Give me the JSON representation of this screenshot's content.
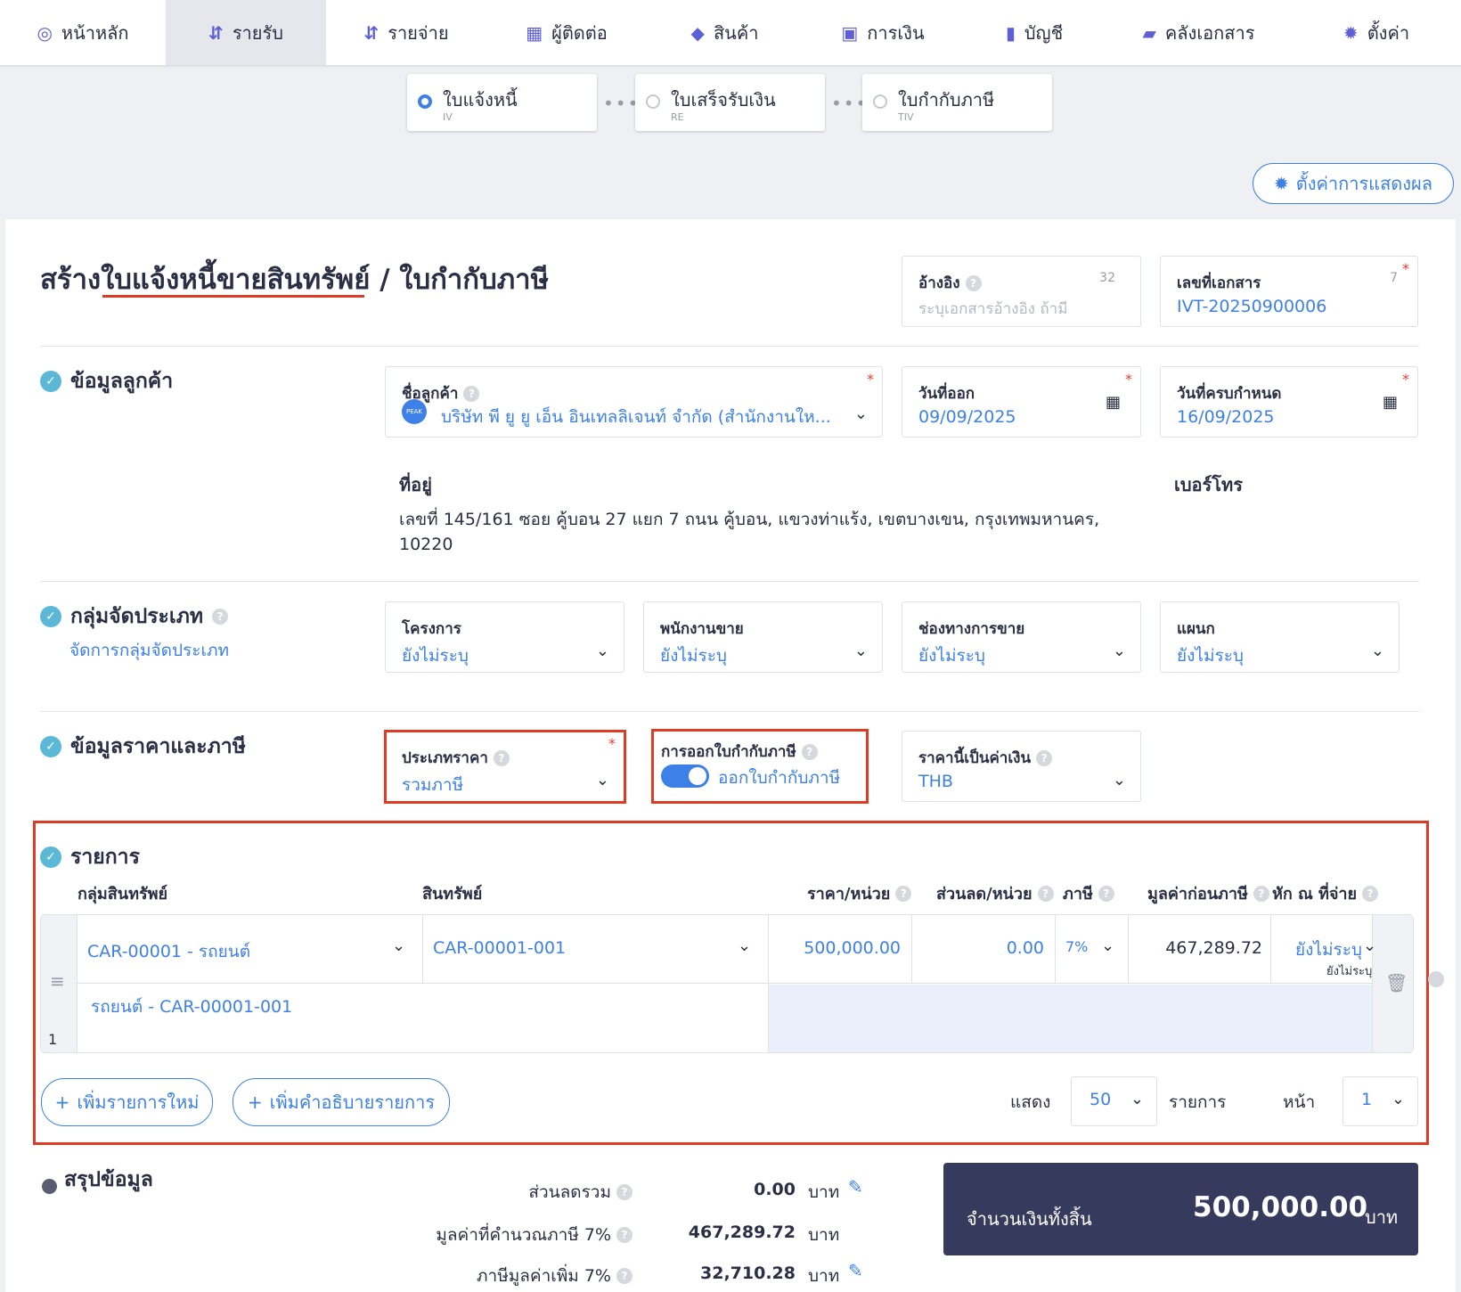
{
  "nav": {
    "items": [
      {
        "icon": "dashboard-icon",
        "glyph": "◎",
        "label": "หน้าหลัก"
      },
      {
        "icon": "income-icon",
        "glyph": "⇵",
        "label": "รายรับ"
      },
      {
        "icon": "expense-icon",
        "glyph": "⇵",
        "label": "รายจ่าย"
      },
      {
        "icon": "contacts-icon",
        "glyph": "▦",
        "label": "ผู้ติดต่อ"
      },
      {
        "icon": "product-icon",
        "glyph": "◆",
        "label": "สินค้า"
      },
      {
        "icon": "finance-icon",
        "glyph": "▣",
        "label": "การเงิน"
      },
      {
        "icon": "account-icon",
        "glyph": "▮",
        "label": "บัญชี"
      },
      {
        "icon": "folder-icon",
        "glyph": "▰",
        "label": "คลังเอกสาร"
      },
      {
        "icon": "gear-icon",
        "glyph": "✹",
        "label": "ตั้งค่า"
      }
    ]
  },
  "steps": [
    {
      "title": "ใบแจ้งหนี้",
      "sub": "IV"
    },
    {
      "title": "ใบเสร็จรับเงิน",
      "sub": "RE"
    },
    {
      "title": "ใบกำกับภาษี",
      "sub": "TIV"
    }
  ],
  "display_settings": {
    "label": "ตั้งค่าการแสดงผล"
  },
  "page": {
    "title": "สร้างใบแจ้งหนี้ขายสินทรัพย์ / ใบกำกับภาษี"
  },
  "reference": {
    "label": "อ้างอิง",
    "count": "32",
    "placeholder": "ระบุเอกสารอ้างอิง ถ้ามี"
  },
  "doc_number": {
    "label": "เลขที่เอกสาร",
    "count": "7",
    "value": "IVT-20250900006"
  },
  "customer_section": {
    "title": "ข้อมูลลูกค้า",
    "name_label": "ชื่อลูกค้า",
    "badge": "PEAK",
    "name_value": "บริษัท พี ยู ยู เอ็น อินเทลลิเจนท์ จำกัด (สำนักงานให...",
    "issue_label": "วันที่ออก",
    "issue_value": "09/09/2025",
    "due_label": "วันที่ครบกำหนด",
    "due_value": "16/09/2025",
    "address_label": "ที่อยู่",
    "address_line1": "เลขที่ 145/161 ซอย คู้บอน 27 แยก 7 ถนน คู้บอน, แขวงท่าแร้ง, เขตบางเขน, กรุงเทพมหานคร,",
    "address_line2": "10220",
    "phone_label": "เบอร์โทร"
  },
  "classify_section": {
    "title": "กลุ่มจัดประเภท",
    "manage_link": "จัดการกลุ่มจัดประเภท",
    "fields": [
      {
        "label": "โครงการ",
        "value": "ยังไม่ระบุ"
      },
      {
        "label": "พนักงานขาย",
        "value": "ยังไม่ระบุ"
      },
      {
        "label": "ช่องทางการขาย",
        "value": "ยังไม่ระบุ"
      },
      {
        "label": "แผนก",
        "value": "ยังไม่ระบุ"
      }
    ]
  },
  "price_section": {
    "title": "ข้อมูลราคาและภาษี",
    "price_type_label": "ประเภทราคา",
    "price_type_value": "รวมภาษี",
    "tax_invoice_label": "การออกใบกำกับภาษี",
    "tax_invoice_value": "ออกใบกำกับภาษี",
    "tax_invoice_on": true,
    "currency_label": "ราคานี้เป็นค่าเงิน",
    "currency_value": "THB"
  },
  "items_section": {
    "title": "รายการ",
    "headers": {
      "asset_group": "กลุ่มสินทรัพย์",
      "asset": "สินทรัพย์",
      "unit_price": "ราคา/หน่วย",
      "discount": "ส่วนลด/หน่วย",
      "vat": "ภาษี",
      "pre_tax": "มูลค่าก่อนภาษี",
      "withholding": "หัก ณ ที่จ่าย"
    },
    "rows": [
      {
        "no": "1",
        "asset_group": "CAR-00001 - รถยนต์",
        "asset": "CAR-00001-001",
        "unit_price": "500,000.00",
        "discount": "0.00",
        "vat": "7%",
        "pre_tax": "467,289.72",
        "withholding": "ยังไม่ระบุ",
        "withholding_sub": "ยังไม่ระบุ",
        "description": "รถยนต์ - CAR-00001-001"
      }
    ],
    "add_item": "เพิ่มรายการใหม่",
    "add_desc": "เพิ่มคำอธิบายรายการ",
    "show_label": "แสดง",
    "per_page": "50",
    "items_label": "รายการ",
    "page_label": "หน้า",
    "page_value": "1"
  },
  "summary": {
    "title": "สรุปข้อมูล",
    "discount_label": "ส่วนลดรวม",
    "discount_value": "0.00",
    "taxable_label": "มูลค่าที่คำนวณภาษี 7%",
    "taxable_value": "467,289.72",
    "vat_label": "ภาษีมูลค่าเพิ่ม 7%",
    "vat_value": "32,710.28",
    "currency": "บาท",
    "total_label": "จำนวนเงินทั้งสิ้น",
    "total_value": "500,000.00"
  },
  "colors": {
    "accent": "#3d80e8",
    "nav_icon": "#5d5fd6",
    "highlight": "#e03b27",
    "total_bg": "#363a5c"
  }
}
